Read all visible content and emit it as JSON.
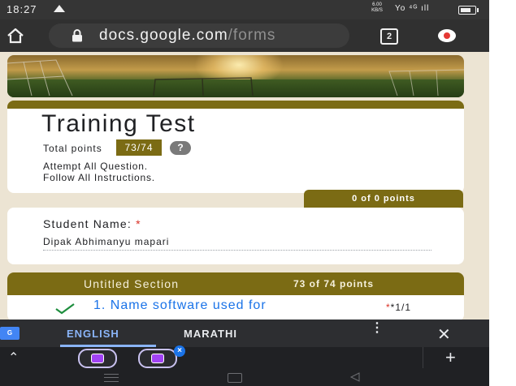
{
  "status_bar": {
    "time": "18:27",
    "net_speed": "6.00 KB/S",
    "signal_text": "Yo ⁴ᴳ ıll"
  },
  "browser": {
    "domain": "docs.google.com",
    "path": "/forms",
    "tab_count": "2"
  },
  "form": {
    "title": "Training Test",
    "total_label": "Total points",
    "score": "73/74",
    "help": "?",
    "description_line1": "Attempt All Question.",
    "description_line2": "Follow All Instructions.",
    "points_tab": "0 of 0 points",
    "name_label": "Student Name:",
    "required_marker": "*",
    "name_value": "Dipak Abhimanyu mapari",
    "section_title": "Untitled Section",
    "section_points": "73 of 74 points",
    "question_1": "1. Name software used for",
    "question_1_score": "*1/1"
  },
  "keyboard": {
    "translate": "G",
    "lang_active": "ENGLISH",
    "lang_other": "MARATHI",
    "more": "⋮",
    "close": "✕"
  },
  "toolbar": {
    "chevron": "⌃",
    "badge": "×",
    "plus": "+"
  },
  "colors": {
    "theme": "#7b6b14",
    "status_bar": "#353535",
    "address_bar": "#303030",
    "page_background": "#ece4d3",
    "link_blue": "#1a73e8"
  }
}
